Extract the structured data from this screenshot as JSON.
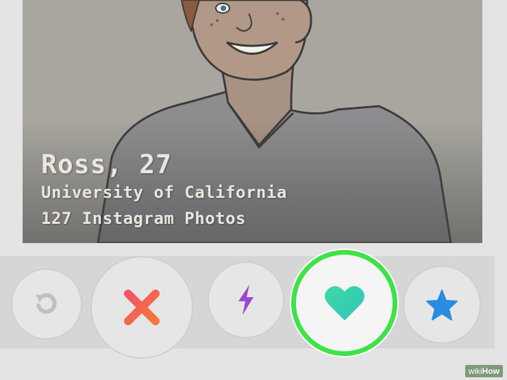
{
  "profile": {
    "name_age": "Ross, 27",
    "school": "University of California",
    "photos": "127 Instagram Photos"
  },
  "actions": {
    "undo": {
      "icon": "undo-icon",
      "color": "#c0c0c0"
    },
    "nope": {
      "icon": "x-icon",
      "color": "#f24d5a"
    },
    "boost": {
      "icon": "lightning-icon",
      "color": "#9a4ad2"
    },
    "like": {
      "icon": "heart-icon",
      "color": "#3ee0b0",
      "highlight": "#40e24a"
    },
    "super_like": {
      "icon": "star-icon",
      "color": "#2a8be0"
    }
  },
  "watermark": {
    "prefix": "wiki",
    "suffix": "How"
  }
}
